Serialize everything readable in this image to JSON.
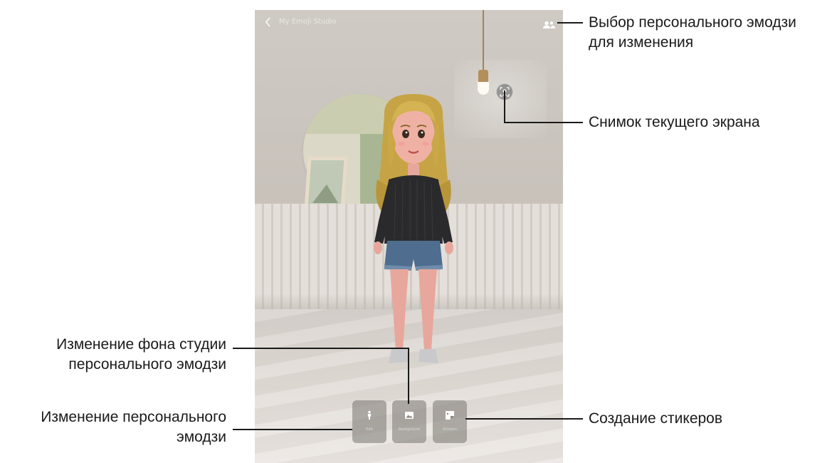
{
  "screen": {
    "topbar": {
      "back_icon": "chevron-left-icon",
      "title": "My Emoji Studio",
      "emoji_select_icon": "people-icon"
    },
    "capture_icon": "camera-icon",
    "toolbar": [
      {
        "key": "avatar",
        "icon": "person-icon",
        "label": "Edit"
      },
      {
        "key": "background",
        "icon": "image-icon",
        "label": "Background"
      },
      {
        "key": "sticker",
        "icon": "sticker-icon",
        "label": "Stickers"
      }
    ]
  },
  "callouts": {
    "select_emoji_line1": "Выбор персонального эмодзи",
    "select_emoji_line2": "для изменения",
    "capture": "Снимок текущего экрана",
    "change_background_line1": "Изменение фона студии",
    "change_background_line2": "персонального эмодзи",
    "change_emoji_line1": "Изменение персонального",
    "change_emoji_line2": "эмодзи",
    "create_stickers": "Создание стикеров"
  }
}
